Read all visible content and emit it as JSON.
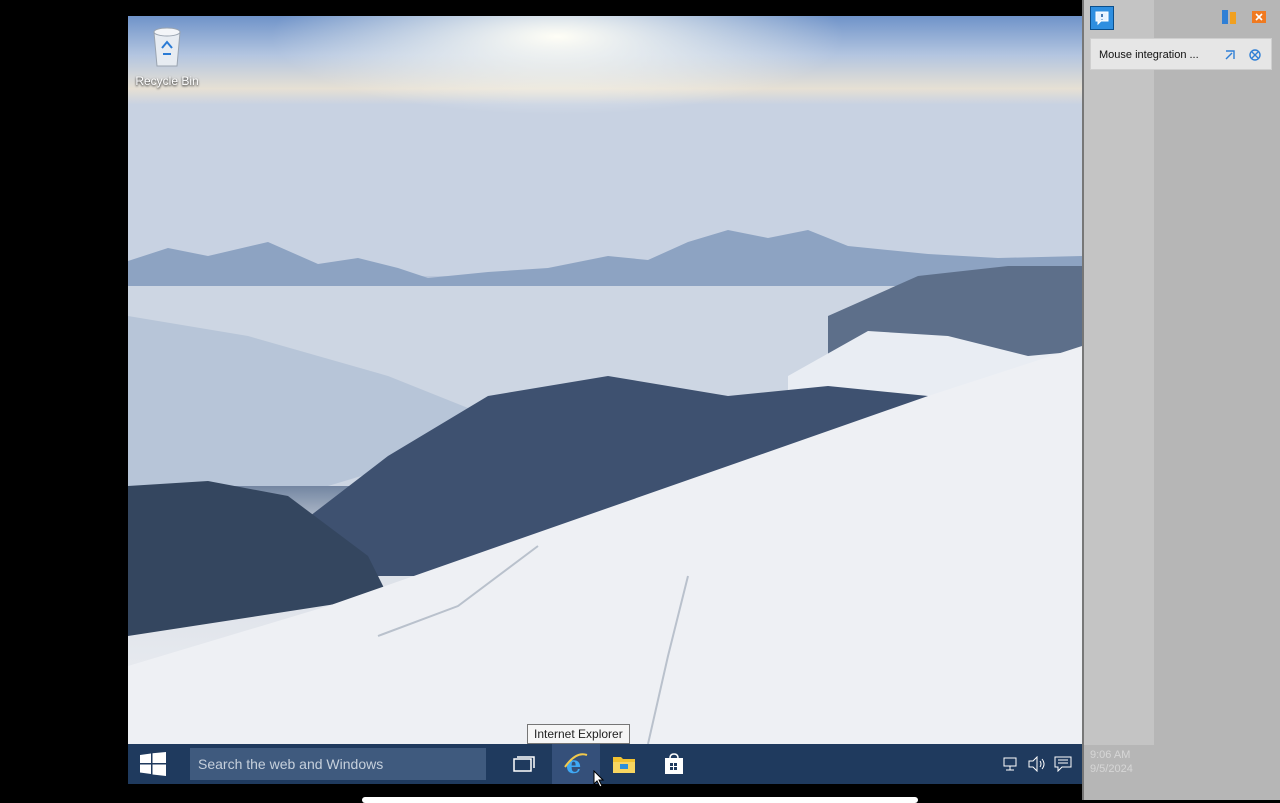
{
  "desktop": {
    "icons": [
      {
        "label": "Recycle Bin",
        "icon": "recycle-bin-icon"
      }
    ]
  },
  "tooltip": {
    "text": "Internet Explorer"
  },
  "taskbar": {
    "start_icon": "windows-logo-icon",
    "search": {
      "placeholder": "Search the web and Windows"
    },
    "apps": [
      {
        "name": "Task View",
        "icon": "task-view-icon"
      },
      {
        "name": "Internet Explorer",
        "icon": "internet-explorer-icon",
        "active": true
      },
      {
        "name": "File Explorer",
        "icon": "folder-icon"
      },
      {
        "name": "Store",
        "icon": "store-icon"
      }
    ],
    "tray": [
      "network-icon",
      "volume-icon",
      "action-center-icon"
    ]
  },
  "host_panel": {
    "toolbar_icons": [
      "message-icon",
      "settings-icon",
      "close-all-icon"
    ],
    "notification": {
      "text": "Mouse integration ...",
      "icons": [
        "mouse-integration-icon",
        "close-icon"
      ]
    },
    "faded_time": "9:06 AM",
    "faded_date": "9/5/2024"
  },
  "colors": {
    "taskbar": "#1f3a5e",
    "accent": "#1e90ff"
  }
}
